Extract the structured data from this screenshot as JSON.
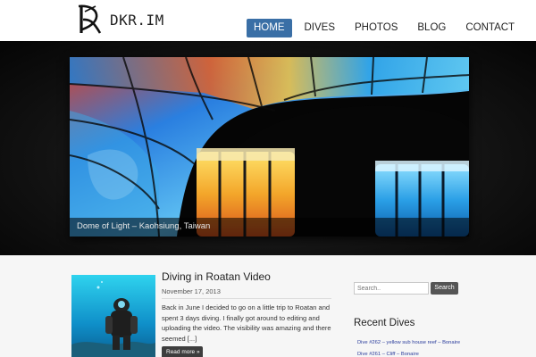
{
  "header": {
    "logo_text": "DKR.IM",
    "nav": [
      {
        "label": "HOME",
        "active": true
      },
      {
        "label": "DIVES",
        "active": false
      },
      {
        "label": "PHOTOS",
        "active": false
      },
      {
        "label": "BLOG",
        "active": false
      },
      {
        "label": "CONTACT",
        "active": false
      }
    ]
  },
  "hero": {
    "caption": "Dome of Light – Kaohsiung, Taiwan"
  },
  "post": {
    "title": "Diving in Roatan Video",
    "date": "November 17, 2013",
    "excerpt": "Back in June I decided to go on a little trip to Roatan and spent 3 days diving. I finally got around to editing and uploading the video. The visibility was amazing and there seemed [...]",
    "read_more": "Read more »"
  },
  "sidebar": {
    "search_placeholder": "Search..",
    "search_button": "Search",
    "recent_title": "Recent Dives",
    "recent_dives": [
      "Dive #262 – yellow sub house reef – Bonaire",
      "Dive #261 – Cliff – Bonaire"
    ]
  },
  "colors": {
    "nav_active": "#3a6fa6",
    "link": "#2a3c9c",
    "hero_bg": "#121212"
  }
}
